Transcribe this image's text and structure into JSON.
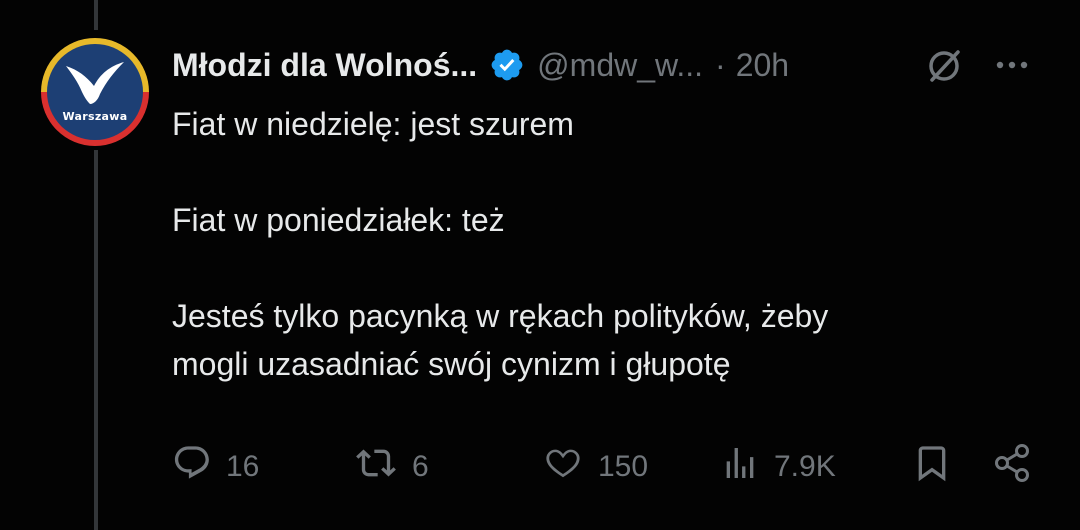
{
  "author": {
    "name": "Młodzi dla Wolnoś...",
    "handle": "@mdw_w...",
    "separator": "·",
    "time": "20h",
    "avatar_label": "Warszawa",
    "verified": true
  },
  "tweet": {
    "lines": [
      "Fiat w niedzielę: jest szurem",
      "Fiat w poniedziałek: też",
      "Jesteś tylko pacynką w rękach polityków, żeby",
      "mogli uzasadniać swój cynizm i głupotę"
    ]
  },
  "actions": {
    "replies": "16",
    "reposts": "6",
    "likes": "150",
    "views": "7.9K"
  },
  "colors": {
    "background": "#030303",
    "text": "#e7e9ea",
    "muted": "#71767b",
    "verified": "#1d9bf0"
  },
  "icons": [
    "reply-icon",
    "repost-icon",
    "like-icon",
    "views-icon",
    "bookmark-icon",
    "share-icon",
    "grok-icon",
    "more-icon",
    "verified-badge-icon"
  ]
}
